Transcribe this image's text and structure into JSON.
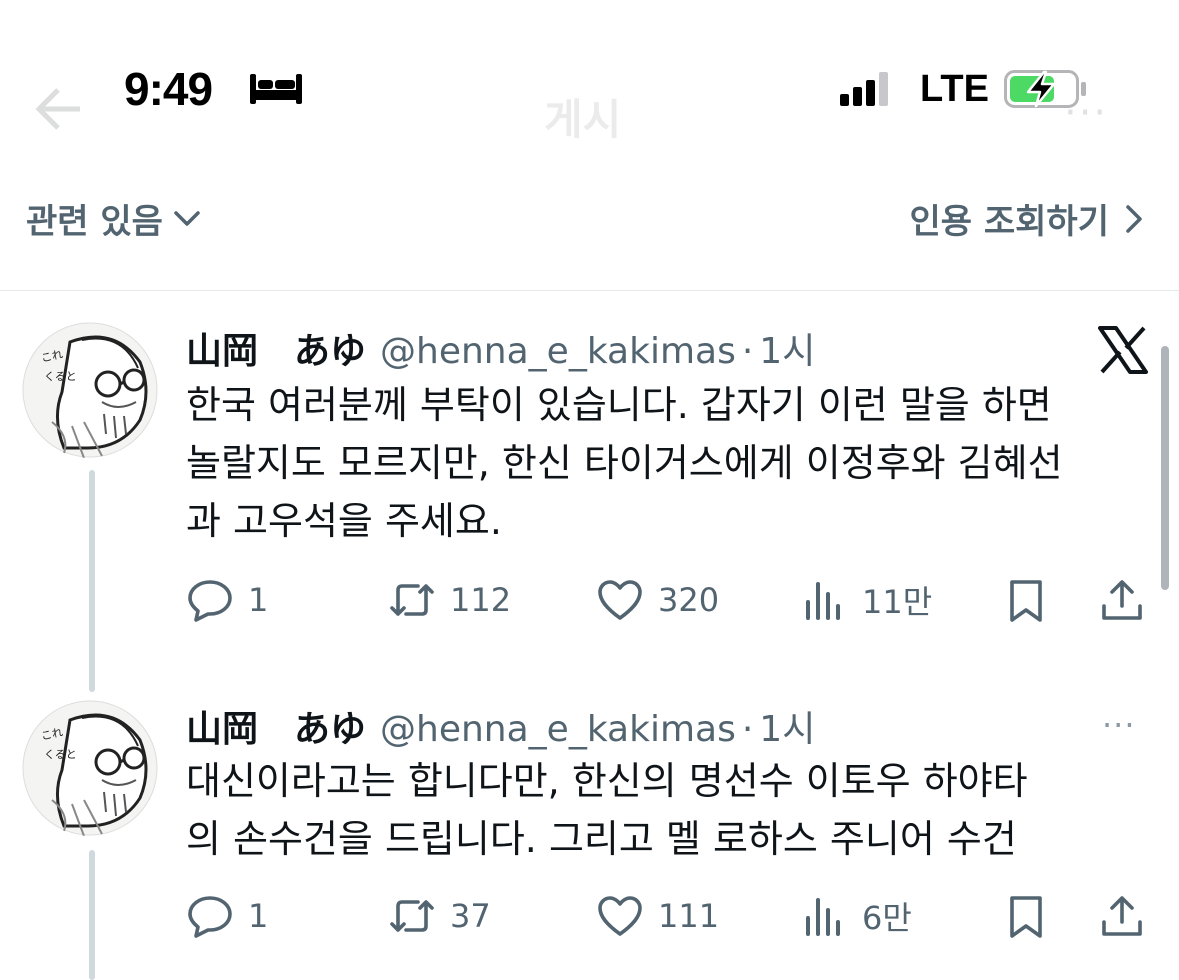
{
  "status_bar": {
    "time": "9:49",
    "network": "LTE",
    "icons": [
      "bed-icon",
      "signal-icon",
      "battery-charging-icon"
    ]
  },
  "header": {
    "title": "게시",
    "more": "···"
  },
  "toolbar": {
    "related_label": "관련 있음",
    "quotes_label": "인용 조회하기"
  },
  "colors": {
    "text": "#0f1419",
    "secondary": "#536471",
    "battery_green": "#4cd964",
    "divider": "#e6e9ec"
  },
  "tweets": [
    {
      "name": "山岡　あゆ",
      "handle": "@henna_e_kakimas",
      "separator": "·",
      "time": "1시",
      "text": "한국 여러분께 부탁이 있습니다. 갑자기 이런 말을 하면\n놀랄지도 모르지만, 한신 타이거스에게 이정후와 김혜선\n과 고우석을 주세요.",
      "stats": {
        "replies": "1",
        "reposts": "112",
        "likes": "320",
        "views": "11만"
      }
    },
    {
      "name": "山岡　あゆ",
      "handle": "@henna_e_kakimas",
      "separator": "·",
      "time": "1시",
      "more": "···",
      "text": "대신이라고는 합니다만, 한신의 명선수 이토우 하야타\n의 손수건을 드립니다. 그리고 멜 로하스 주니어 수건",
      "stats": {
        "replies": "1",
        "reposts": "37",
        "likes": "111",
        "views": "6만"
      }
    }
  ]
}
